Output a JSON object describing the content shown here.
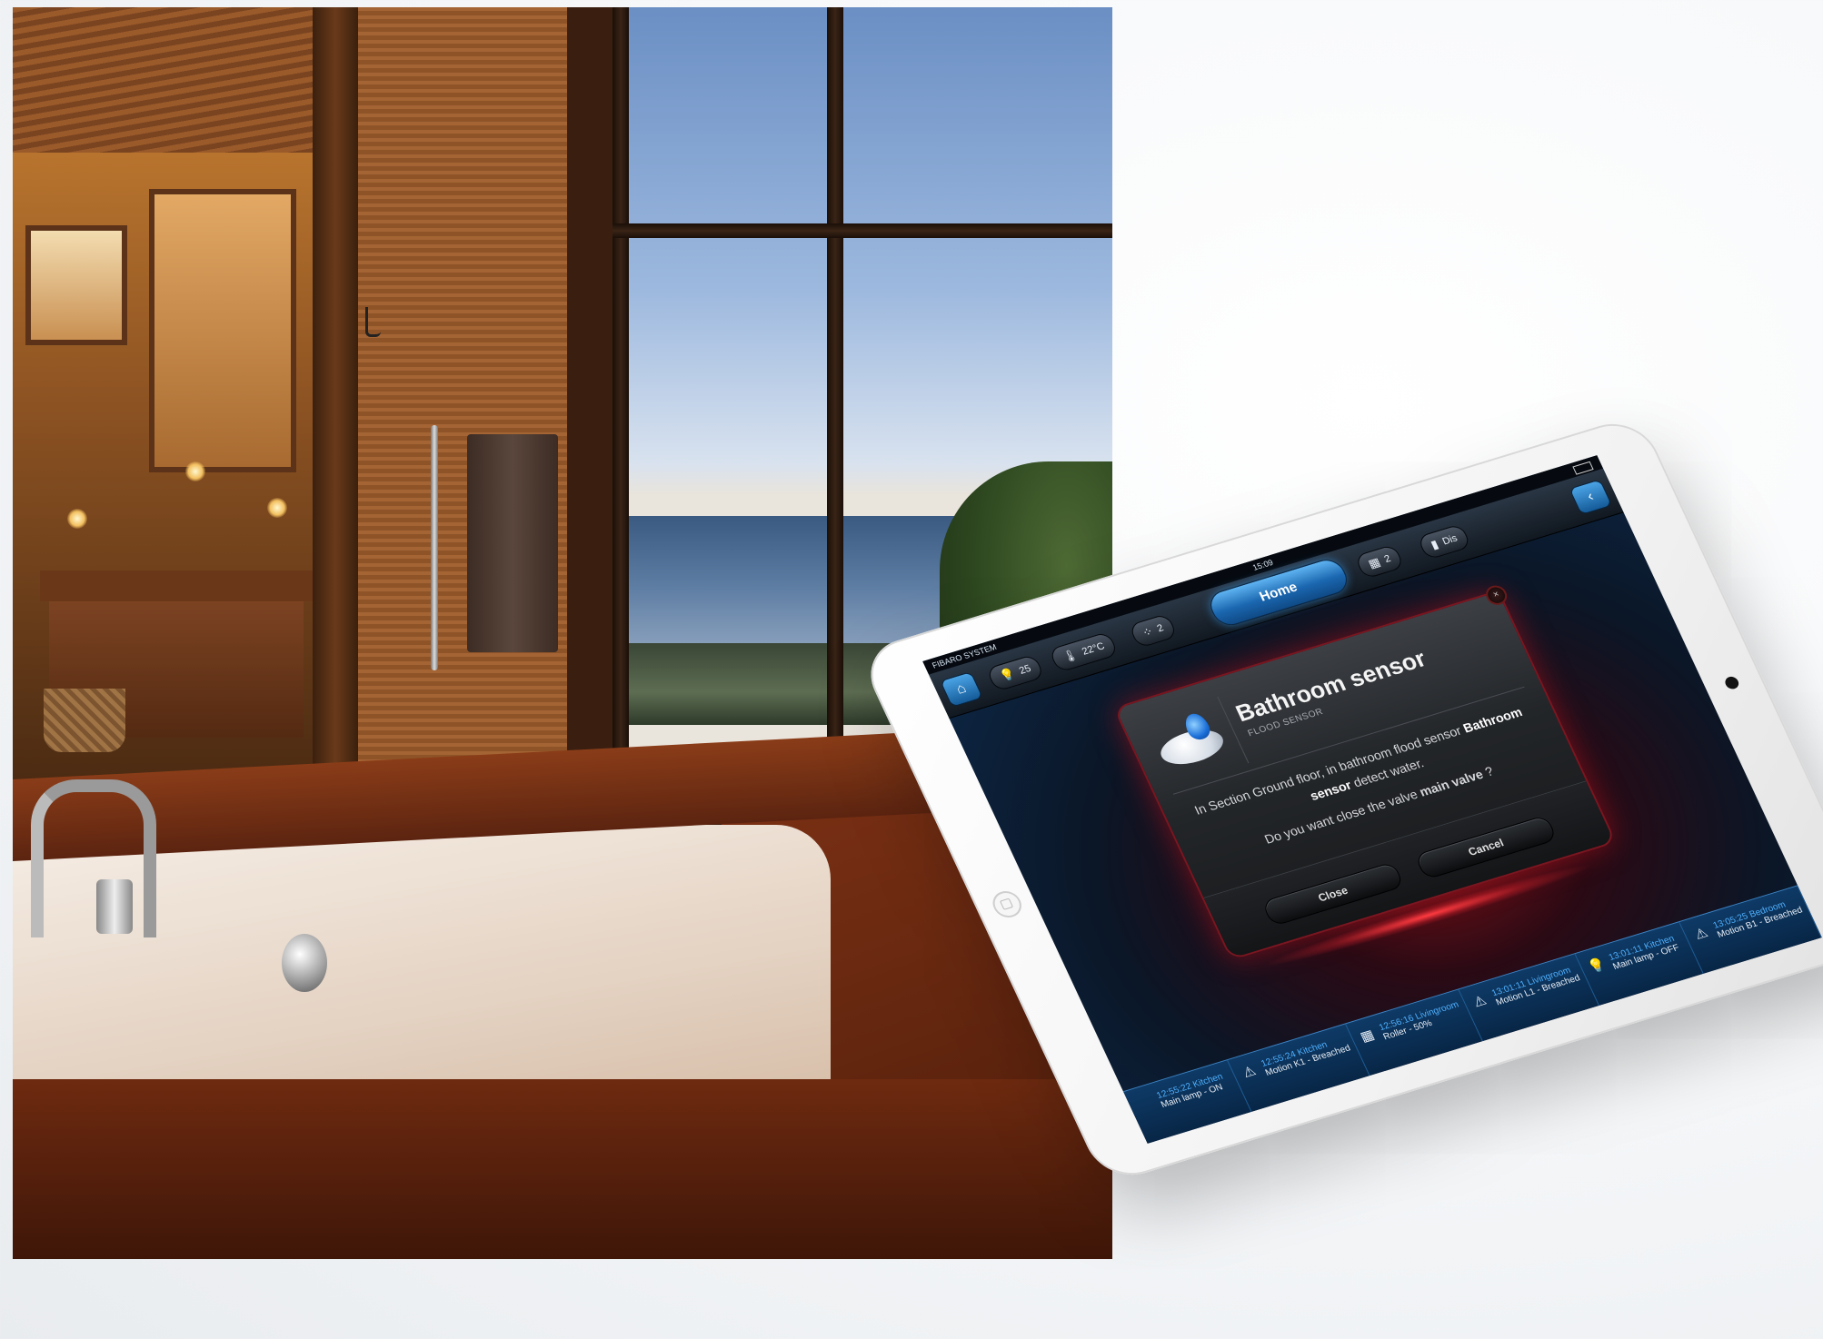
{
  "tablet": {
    "statusbar": {
      "carrier": "FIBARO SYSTEM",
      "time": "15:09"
    },
    "topbar": {
      "home_label": "Home",
      "pills": [
        {
          "icon": "lightbulb-icon",
          "glyph": "💡",
          "label": "25"
        },
        {
          "icon": "thermometer-icon",
          "glyph": "🌡",
          "label": "22°C"
        },
        {
          "icon": "motion-sensor-icon",
          "glyph": "⁘",
          "label": "2"
        },
        {
          "icon": "window-blind-icon",
          "glyph": "▦",
          "label": "2"
        },
        {
          "icon": "door-icon",
          "glyph": "▮",
          "label": "Dis"
        }
      ],
      "logo_glyph": "⌂",
      "back_glyph": "‹"
    },
    "dialog": {
      "title": "Bathroom sensor",
      "subtitle": "FLOOD SENSOR",
      "message_part1": "In Section Ground floor, in bathroom flood sensor ",
      "message_bold": "Bathroom sensor",
      "message_part2": " detect water.",
      "question_part1": "Do you want close the valve ",
      "question_bold": "main valve",
      "question_part2": " ?",
      "close_label": "Close",
      "cancel_label": "Cancel",
      "x_glyph": "×"
    },
    "events": [
      {
        "icon": "lightbulb-icon",
        "glyph": "",
        "time": "12:55:22 Kitchen",
        "desc": "Main lamp - ON"
      },
      {
        "icon": "motion-icon",
        "glyph": "⚠",
        "time": "12:55:24 Kitchen",
        "desc": "Motion K1 - Breached"
      },
      {
        "icon": "roller-blind-icon",
        "glyph": "▦",
        "time": "12:56:16 Livingroom",
        "desc": "Roller - 50%"
      },
      {
        "icon": "motion-icon",
        "glyph": "⚠",
        "time": "13:01:11 Livingroom",
        "desc": "Motion L1 - Breached"
      },
      {
        "icon": "lightbulb-icon",
        "glyph": "💡",
        "time": "13:01:11 Kitchen",
        "desc": "Main lamp - OFF"
      },
      {
        "icon": "motion-icon",
        "glyph": "⚠",
        "time": "13:05:25 Bedroom",
        "desc": "Motion B1 - Breached"
      }
    ]
  }
}
